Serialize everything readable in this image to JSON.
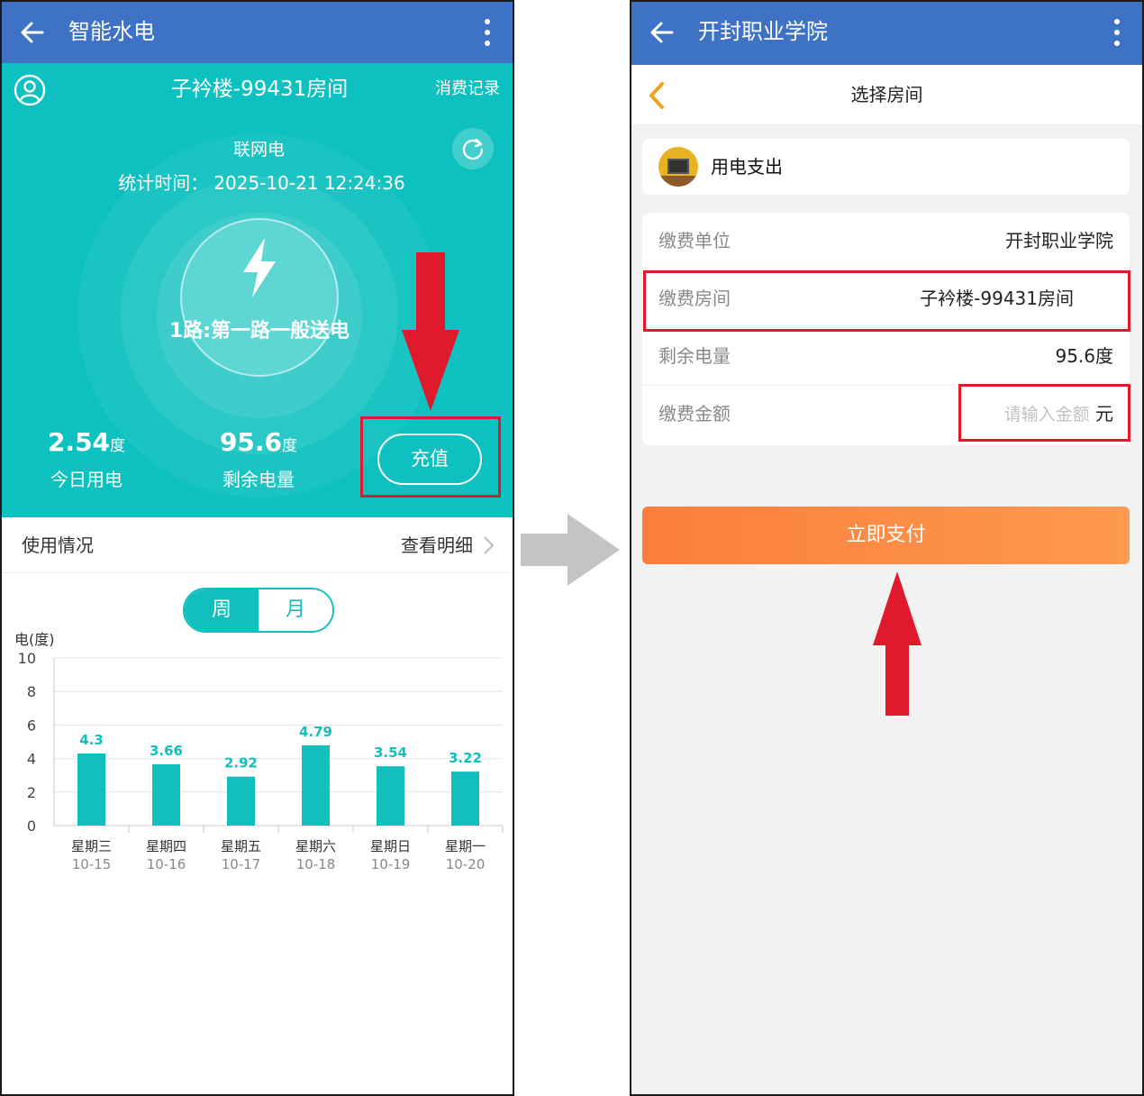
{
  "left_screen": {
    "appbar": {
      "title": "智能水电"
    },
    "header": {
      "room": "子衿楼-99431房间",
      "records_link": "消费记录",
      "meter_type": "联网电",
      "stat_time_label": "统计时间：",
      "stat_time_value": "2025-10-21 12:24:36",
      "route": "1路:第一路一般送电"
    },
    "stats": {
      "today_value": "2.54",
      "today_unit": "度",
      "today_label": "今日用电",
      "remain_value": "95.6",
      "remain_unit": "度",
      "remain_label": "剩余电量",
      "recharge_label": "充值"
    },
    "usage": {
      "label": "使用情况",
      "detail_link": "查看明细"
    },
    "period_toggle": {
      "week": "周",
      "month": "月",
      "selected": "week"
    }
  },
  "right_screen": {
    "appbar": {
      "title": "开封职业学院"
    },
    "subbar": {
      "title": "选择房间"
    },
    "payee": {
      "name": "用电支出"
    },
    "form": {
      "rows": [
        {
          "key": "缴费单位",
          "value": "开封职业学院"
        },
        {
          "key": "缴费房间",
          "value": "子衿楼-99431房间"
        },
        {
          "key": "剩余电量",
          "value": "95.6度"
        }
      ],
      "amount_label": "缴费金额",
      "amount_placeholder": "请输入金额",
      "amount_unit": "元"
    },
    "pay_button": "立即支付"
  },
  "colors": {
    "teal": "#0cc1bf",
    "appbar_blue": "#3d72c4",
    "annotation_red": "#e0192d",
    "pay_orange": "#fb7e3c",
    "bar": "#11c0bd"
  },
  "chart_data": {
    "type": "bar",
    "ylabel": "电(度)",
    "ylim": [
      0,
      10
    ],
    "yticks": [
      0,
      2,
      4,
      6,
      8,
      10
    ],
    "categories": [
      "星期三",
      "星期四",
      "星期五",
      "星期六",
      "星期日",
      "星期一"
    ],
    "dates": [
      "10-15",
      "10-16",
      "10-17",
      "10-18",
      "10-19",
      "10-20"
    ],
    "values": [
      4.3,
      3.66,
      2.92,
      4.79,
      3.54,
      3.22
    ],
    "value_labels": [
      "4.3",
      "3.66",
      "2.92",
      "4.79",
      "3.54",
      "3.22"
    ],
    "grid": true
  }
}
